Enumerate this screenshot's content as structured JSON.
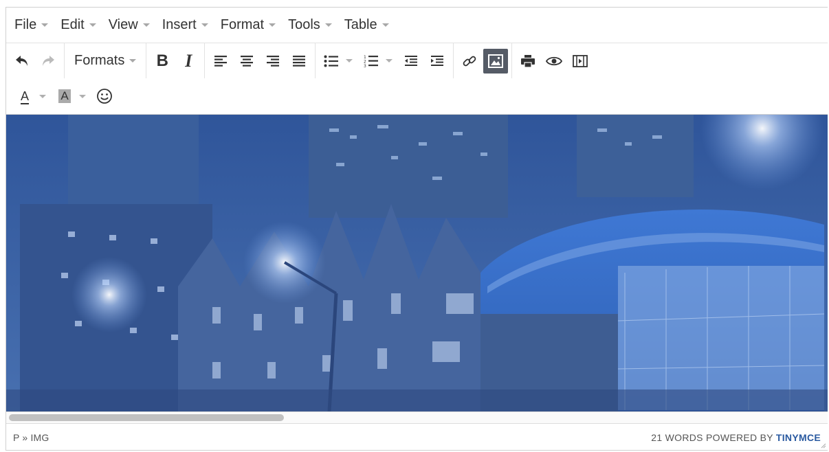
{
  "menubar": {
    "items": [
      {
        "label": "File"
      },
      {
        "label": "Edit"
      },
      {
        "label": "View"
      },
      {
        "label": "Insert"
      },
      {
        "label": "Format"
      },
      {
        "label": "Tools"
      },
      {
        "label": "Table"
      }
    ]
  },
  "toolbar": {
    "formats_label": "Formats",
    "bold_label": "B",
    "italic_label": "I",
    "text_color_label": "A",
    "background_color_label": "A",
    "icons": [
      "undo-icon",
      "redo-icon",
      "align-left-icon",
      "align-center-icon",
      "align-right-icon",
      "align-justify-icon",
      "bullet-list-icon",
      "numbered-list-icon",
      "outdent-icon",
      "indent-icon",
      "link-icon",
      "image-icon",
      "print-icon",
      "preview-icon",
      "media-icon",
      "emoticons-icon"
    ],
    "accent_active": "#555b66"
  },
  "statusbar": {
    "path": "P » IMG",
    "word_count": "21 WORDS",
    "powered_by": "POWERED BY",
    "brand": "TINYMCE",
    "brand_color": "#2a5aa0"
  }
}
